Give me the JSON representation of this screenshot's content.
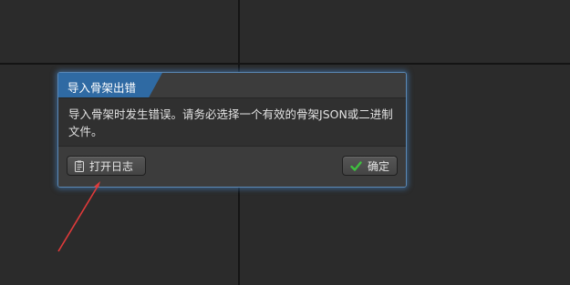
{
  "dialog": {
    "title": "导入骨架出错",
    "message": "导入骨架时发生错误。请务必选择一个有效的骨架JSON或二进制文件。",
    "buttons": {
      "open_log": {
        "label": "打开日志",
        "icon": "clipboard-icon"
      },
      "confirm": {
        "label": "确定",
        "icon": "checkmark-icon"
      }
    }
  },
  "colors": {
    "title_accent": "#2f6aa3",
    "dialog_border": "#5a88b6",
    "check_green": "#3fbf3f",
    "annotation_arrow": "#e03a3a"
  }
}
